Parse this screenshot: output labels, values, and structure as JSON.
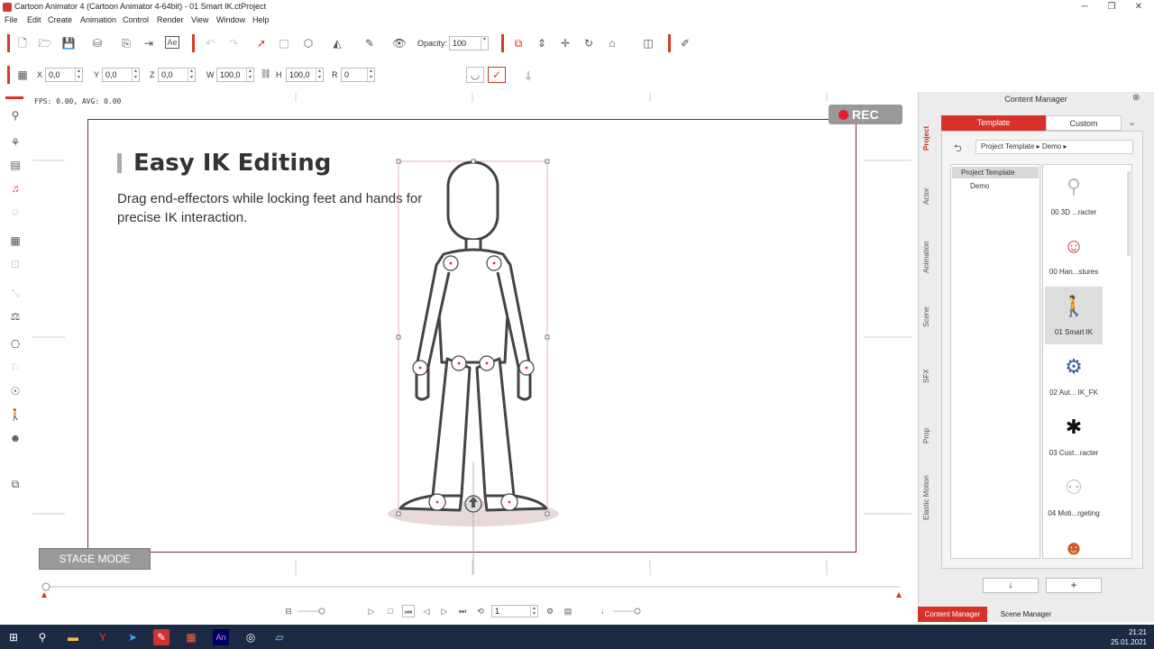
{
  "window": {
    "title": "Cartoon Animator 4  (Cartoon Animator 4-64bit) - 01 Smart IK.ctProject"
  },
  "menu": [
    "File",
    "Edit",
    "Create",
    "Animation",
    "Control",
    "Render",
    "View",
    "Window",
    "Help"
  ],
  "toolbar1": {
    "opacity_label": "Opacity:",
    "opacity_value": "100"
  },
  "toolbar2": {
    "x_label": "X",
    "x_value": "0,0",
    "y_label": "Y",
    "y_value": "0,0",
    "z_label": "Z",
    "z_value": "0,0",
    "w_label": "W",
    "w_value": "100,0",
    "h_label": "H",
    "h_value": "100,0",
    "r_label": "R",
    "r_value": "0"
  },
  "viewport": {
    "fps": "FPS: 0.00, AVG: 0.00",
    "rec_label": "REC",
    "heading": "Easy IK Editing",
    "description": "Drag end-effectors while locking feet and hands for precise IK interaction.",
    "stage_mode": "STAGE MODE"
  },
  "playback": {
    "frame_value": "1"
  },
  "content_manager": {
    "title": "Content Manager",
    "vertical_tabs": [
      "Project",
      "Actor",
      "Animation",
      "Scene",
      "SFX",
      "Prop",
      "Elastic Motion"
    ],
    "tab_template": "Template",
    "tab_custom": "Custom",
    "path": "Project Template ▸ Demo ▸",
    "tree_root": "Project Template",
    "tree_child": "Demo",
    "thumbnails": [
      {
        "label": "00 3D ...racter",
        "icon": "sketch-character"
      },
      {
        "label": "00 Han...stures",
        "icon": "girl-character"
      },
      {
        "label": "01 Smart IK",
        "icon": "ik-character"
      },
      {
        "label": "02 Aut... IK_FK",
        "icon": "robot-character"
      },
      {
        "label": "03 Cust...racter",
        "icon": "spider-character"
      },
      {
        "label": "04 Moti...rgeting",
        "icon": "motion-characters"
      },
      {
        "label": "",
        "icon": "redhead-character"
      }
    ],
    "bottom_tab_cm": "Content Manager",
    "bottom_tab_sm": "Scene Manager"
  },
  "taskbar": {
    "time": "21:21",
    "date": "25.01.2021"
  },
  "colors": {
    "accent": "#d8312a",
    "rec_dot": "#e0202a",
    "taskbar": "#1d2a44"
  }
}
